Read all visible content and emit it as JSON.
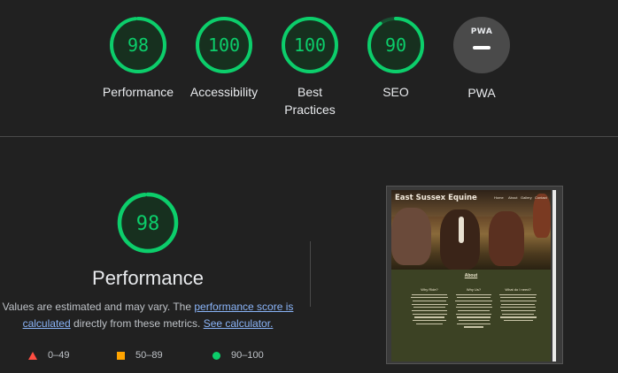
{
  "categories": [
    {
      "label": "Performance",
      "score": "98",
      "value": 98
    },
    {
      "label": "Accessibility",
      "score": "100",
      "value": 100
    },
    {
      "label": "Best Practices",
      "score": "100",
      "value": 100
    },
    {
      "label": "SEO",
      "score": "90",
      "value": 90
    },
    {
      "label": "PWA",
      "score": "PWA",
      "value": null
    }
  ],
  "main": {
    "score": "98",
    "score_value": 98,
    "title": "Performance",
    "desc_prefix": "Values are estimated and may vary. The ",
    "link_score": "performance score is calculated",
    "desc_middle": " directly from these metrics. ",
    "link_calc": "See calculator.",
    "legend": [
      {
        "range": "0–49",
        "color": "#ff4e42"
      },
      {
        "range": "50–89",
        "color": "#ffa400"
      },
      {
        "range": "90–100",
        "color": "#0cce6b"
      }
    ]
  },
  "screenshot": {
    "site_title": "East Sussex Equine",
    "nav": [
      "Home",
      "About",
      "Gallery",
      "Contact"
    ],
    "section": "About",
    "columns": [
      "Why Ride?",
      "Why Us?",
      "What do I need?"
    ]
  },
  "colors": {
    "pass": "#0cce6b",
    "background": "#212121"
  }
}
